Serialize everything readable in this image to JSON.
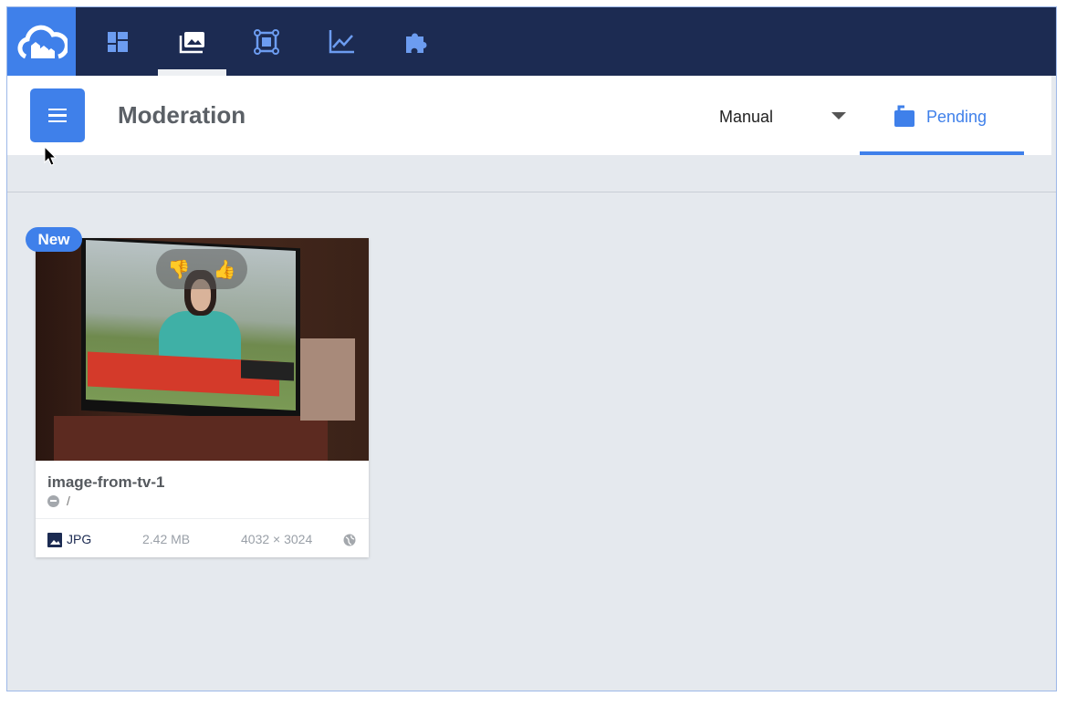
{
  "topnav": {
    "items": [
      {
        "icon": "cloud-logo-icon"
      },
      {
        "icon": "dashboard-icon"
      },
      {
        "icon": "media-library-icon",
        "active": true
      },
      {
        "icon": "transformations-icon"
      },
      {
        "icon": "reports-icon"
      },
      {
        "icon": "addons-icon"
      }
    ]
  },
  "header": {
    "title": "Moderation",
    "mode_select": "Manual",
    "tab_label": "Pending"
  },
  "card": {
    "badge": "New",
    "name": "image-from-tv-1",
    "folder": "/",
    "format": "JPG",
    "size": "2.42 MB",
    "dimensions": "4032 × 3024"
  },
  "colors": {
    "nav": "#1c2b52",
    "accent": "#3f80ea",
    "background": "#e5e9ee"
  }
}
